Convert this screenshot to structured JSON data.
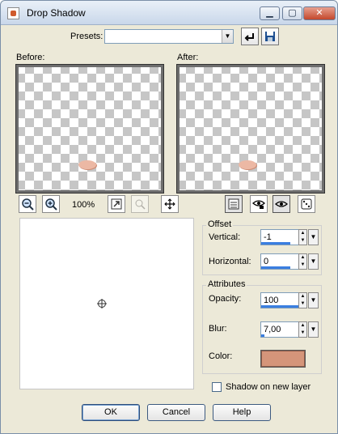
{
  "window": {
    "title": "Drop Shadow"
  },
  "titlebar": {
    "minimize": "▁",
    "maximize": "▢",
    "close": "✕"
  },
  "presets": {
    "label": "Presets:",
    "value": ""
  },
  "previews": {
    "before_label": "Before:",
    "after_label": "After:"
  },
  "zoom": {
    "level": "100%"
  },
  "offset": {
    "group_title": "Offset",
    "vertical_label": "Vertical:",
    "vertical_value": "-1",
    "horizontal_label": "Horizontal:",
    "horizontal_value": "0"
  },
  "attributes": {
    "group_title": "Attributes",
    "opacity_label": "Opacity:",
    "opacity_value": "100",
    "blur_label": "Blur:",
    "blur_value": "7,00",
    "color_label": "Color:",
    "color_hex": "#d5957a"
  },
  "shadow_on_new_layer": {
    "label": "Shadow on new layer",
    "checked": false
  },
  "buttons": {
    "ok": "OK",
    "cancel": "Cancel",
    "help": "Help"
  }
}
